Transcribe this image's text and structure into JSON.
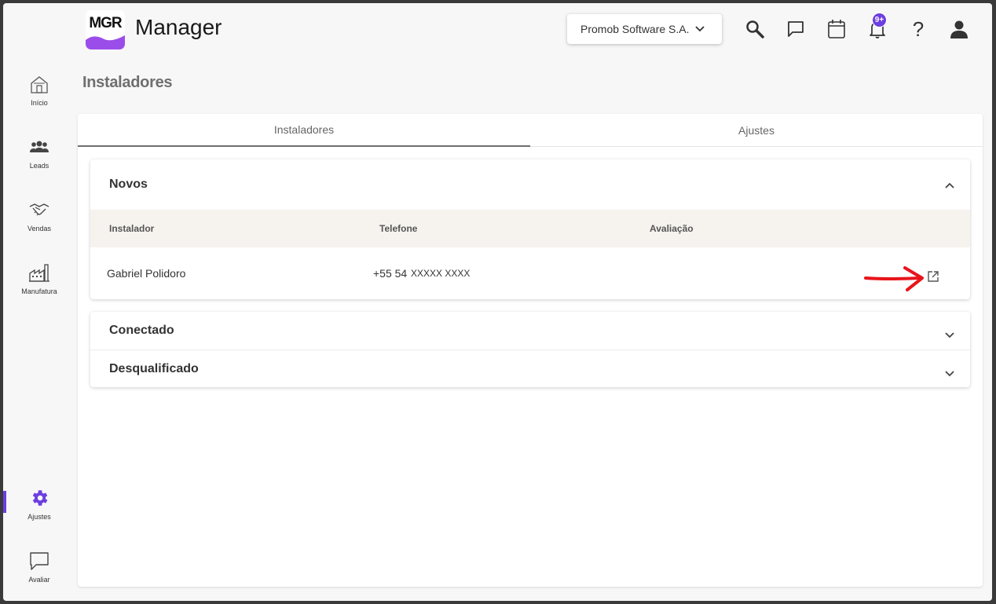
{
  "header": {
    "logo_text": "MGR",
    "app_title": "Manager",
    "company": "Promob Software S.A.",
    "notification_badge": "9+",
    "icons": [
      "search-icon",
      "chat-icon",
      "calendar-icon",
      "bell-icon",
      "help-icon",
      "user-icon"
    ],
    "colors": {
      "accent": "#6c3fe0",
      "logo_wave": "#9b4dea"
    }
  },
  "sidebar": {
    "items": [
      {
        "label": "Início",
        "icon": "home-icon"
      },
      {
        "label": "Leads",
        "icon": "people-icon"
      },
      {
        "label": "Vendas",
        "icon": "handshake-icon"
      },
      {
        "label": "Manufatura",
        "icon": "factory-icon"
      },
      {
        "label": "Ajustes",
        "icon": "gear-icon",
        "active": true
      },
      {
        "label": "Avaliar",
        "icon": "feedback-icon"
      }
    ]
  },
  "page": {
    "title": "Instaladores",
    "tabs": [
      {
        "label": "Instaladores",
        "active": true
      },
      {
        "label": "Ajustes",
        "active": false
      }
    ]
  },
  "sections": {
    "novos": {
      "title": "Novos",
      "expanded": true,
      "columns": [
        "Instalador",
        "Telefone",
        "Avaliação"
      ],
      "rows": [
        {
          "instalador": "Gabriel Polidoro",
          "telefone": "+55 54",
          "telefone_mask": "XXXXX XXXX",
          "avaliacao": ""
        }
      ]
    },
    "conectado": {
      "title": "Conectado",
      "expanded": false
    },
    "desqualificado": {
      "title": "Desqualificado",
      "expanded": false
    }
  }
}
